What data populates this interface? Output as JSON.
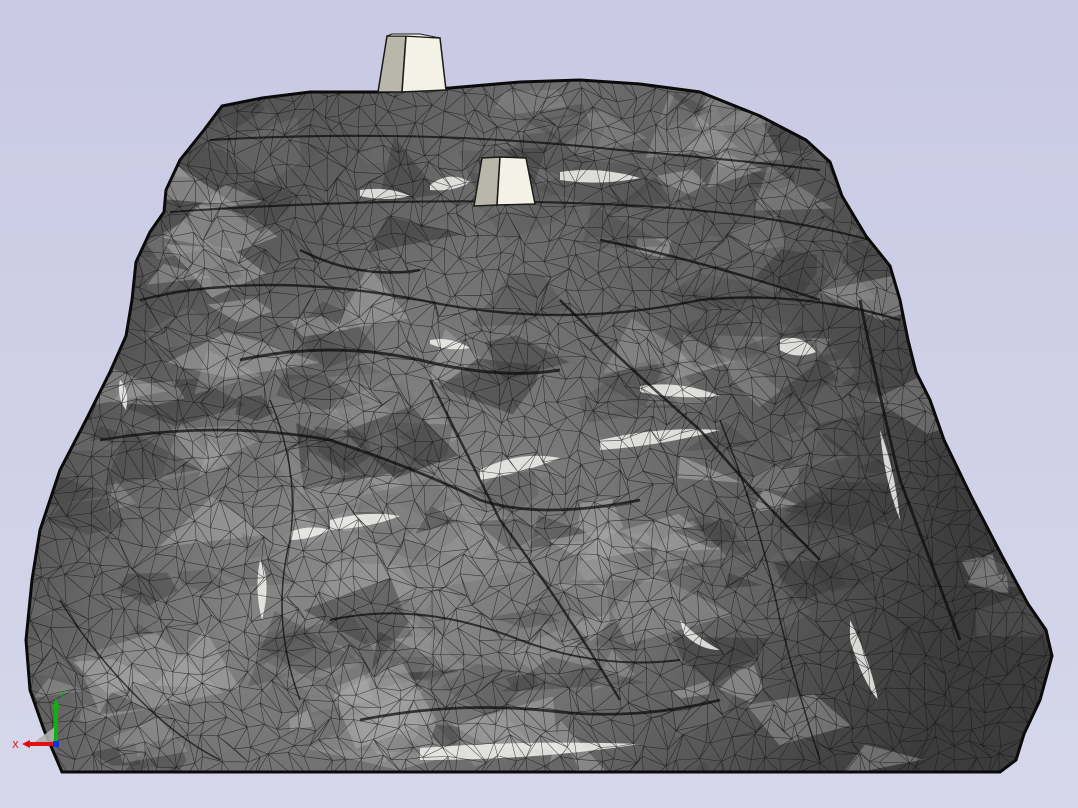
{
  "viewport": {
    "background_top": "#c9c9e4",
    "background_bottom": "#d6d7ea"
  },
  "model": {
    "surface_color": "#6e6e6e",
    "surface_shadow": "#3c3c3c",
    "surface_highlight": "#a8a8a8",
    "mesh_color": "#141414",
    "gap_color": "#f2f2ef",
    "block_face_light": "#f4f2e6",
    "block_face_dark": "#b9b7aa",
    "block_edge": "#1a1a1a"
  },
  "triad": {
    "x_label": "X",
    "y_label": "Y",
    "x_color": "#e01010",
    "y_color": "#10b010",
    "z_color": "#1030e0",
    "cone_color": "#b0b0b0"
  }
}
